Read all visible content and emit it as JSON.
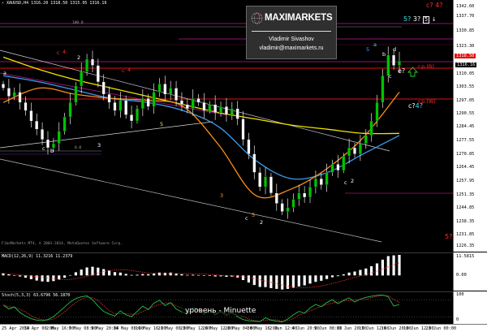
{
  "window": {
    "symbol_header": "XAUUSD,H4 1316.20 1318.50 1315.95 1316.16",
    "copyright": "FiboMarkets MT4, © 2001-2014, MetaQuotes Software Corp."
  },
  "logo": {
    "brand": "MAXIMARKETS",
    "author": "Vladimir Sivashov",
    "email": "vladimir@maximarkets.ru"
  },
  "caption": "уровень - Minuette",
  "levels": {
    "rp_b": "r.p.(B)",
    "rp_w": "r.p.(W)",
    "fib_100": "100.0",
    "fib_0": "0.0"
  },
  "forecast_labels": {
    "top_c": "c?",
    "top_4": "4?",
    "top_5": "5?",
    "top_3": "3?",
    "top_box": "5",
    "e_q": "e?",
    "c4_c": "c?",
    "c4_4": "4?",
    "bot_5": "5?",
    "bot_a": "A?"
  },
  "wave_labels": [
    "a",
    "c",
    "b",
    "c",
    "4",
    "2",
    "3",
    "c",
    "4",
    "5",
    "c",
    "5",
    "2",
    "3",
    "c",
    "2",
    "5",
    "a",
    "b",
    "c",
    "d"
  ],
  "price_axis": {
    "ticks": [
      "1342.60",
      "1337.70",
      "1330.85",
      "1323.30",
      "1310.05",
      "1303.55",
      "1297.05",
      "1290.55",
      "1284.45",
      "1277.55",
      "1270.85",
      "1264.45",
      "1257.95",
      "1251.35",
      "1244.85",
      "1238.35",
      "1231.85",
      "1226.35"
    ],
    "ask_tag": "1318.50",
    "bid_tag": "1316.16"
  },
  "time_axis": {
    "labels": [
      "25 Apr 2014",
      "30 Apr 00:00",
      "2 May 16:00",
      "7 May 08:00",
      "9 May 20:00",
      "14 May 08:00",
      "16 May 16:00",
      "21 May 00:00",
      "23 May 12:00",
      "26 May 12:00",
      "28 May 04:00",
      "30 May 16:00",
      "2 Jun 12:00",
      "4 Jun 20:00",
      "9 Jun 08:00",
      "11 Jun 20:00",
      "13 Jun 12:00",
      "16 Jun 20:00",
      "18 Jun 12:00",
      "23 Jun 00:00"
    ]
  },
  "macd": {
    "header": "MACD(12,26,9) 11.3216 11.2379",
    "top_tick": "11.5815",
    "zero_tick": "0.00",
    "hist": [
      1.2,
      0.6,
      0.1,
      -0.6,
      -1.3,
      -2.1,
      -2.9,
      -3.4,
      -3.6,
      -3.2,
      -2.4,
      -1.3,
      0.2,
      1.8,
      3.3,
      4.5,
      4.9,
      4.4,
      3.6,
      2.8,
      1.9,
      1.6,
      0.9,
      0.3,
      0.4,
      0.8,
      0.7,
      1.1,
      1.6,
      1.5,
      1.6,
      1.1,
      0.7,
      0.3,
      0.4,
      0.2,
      -0.2,
      -0.3,
      -0.6,
      -0.5,
      -0.8,
      -0.7,
      -1.2,
      -2.6,
      -4.0,
      -5.4,
      -6.5,
      -6.6,
      -7.2,
      -7.6,
      -7.9,
      -7.6,
      -7.0,
      -6.2,
      -5.6,
      -4.6,
      -3.6,
      -3.0,
      -2.0,
      -1.0,
      -0.4,
      0.6,
      1.6,
      2.2,
      3.1,
      3.9,
      5.2,
      6.8,
      8.9,
      10.9,
      11.3,
      11.58
    ]
  },
  "stochastic": {
    "header": "Stoch(5,3,3) 63.6796 56.1870",
    "top_tick": "100",
    "bottom_tick": "0",
    "k": [
      62,
      48,
      55,
      36,
      24,
      15,
      10,
      8,
      12,
      22,
      38,
      55,
      72,
      84,
      90,
      93,
      80,
      58,
      40,
      31,
      24,
      42,
      28,
      22,
      40,
      58,
      46,
      68,
      78,
      60,
      70,
      48,
      38,
      32,
      52,
      46,
      30,
      44,
      28,
      40,
      26,
      36,
      22,
      12,
      8,
      6,
      5,
      18,
      10,
      6,
      4,
      14,
      28,
      40,
      34,
      52,
      64,
      56,
      70,
      80,
      66,
      78,
      86,
      72,
      82,
      88,
      92,
      95,
      96,
      90,
      58,
      64
    ]
  },
  "colors": {
    "bull": "#00c400",
    "bear": "#ffffff",
    "ma_yellow": "#f2e200",
    "ma_blue": "#3d9be9",
    "ma_orange": "#ff8c1a",
    "stoch_main": "#24c24a",
    "stoch_signal": "#e33333",
    "resistance": "#d4207f",
    "pivot_red": "#e01010"
  },
  "chart_data": {
    "type": "line",
    "close": [
      1303,
      1299,
      1301,
      1296,
      1292,
      1287,
      1283,
      1278,
      1274,
      1276,
      1282,
      1289,
      1296,
      1304,
      1311,
      1317,
      1314,
      1306,
      1300,
      1296,
      1292,
      1297,
      1290,
      1287,
      1293,
      1298,
      1294,
      1301,
      1305,
      1300,
      1303,
      1297,
      1295,
      1293,
      1298,
      1296,
      1292,
      1295,
      1291,
      1294,
      1290,
      1293,
      1288,
      1278,
      1271,
      1262,
      1255,
      1260,
      1252,
      1247,
      1243,
      1245,
      1249,
      1252,
      1250,
      1255,
      1259,
      1256,
      1262,
      1266,
      1263,
      1270,
      1274,
      1271,
      1276,
      1280,
      1287,
      1296,
      1309,
      1319,
      1314,
      1316.16
    ],
    "ma_yellow": [
      1318,
      1312,
      1307,
      1303,
      1299,
      1295,
      1291,
      1288,
      1285,
      1283,
      1281,
      1281
    ],
    "ma_blue": [
      1309,
      1306,
      1302,
      1298,
      1296,
      1292,
      1284,
      1268,
      1259,
      1262,
      1271,
      1280
    ],
    "ma_orange": [
      1296,
      1303,
      1300,
      1298,
      1297,
      1294,
      1275,
      1251,
      1254,
      1264,
      1279,
      1301
    ],
    "ylim": [
      1226.35,
      1342.6
    ]
  }
}
